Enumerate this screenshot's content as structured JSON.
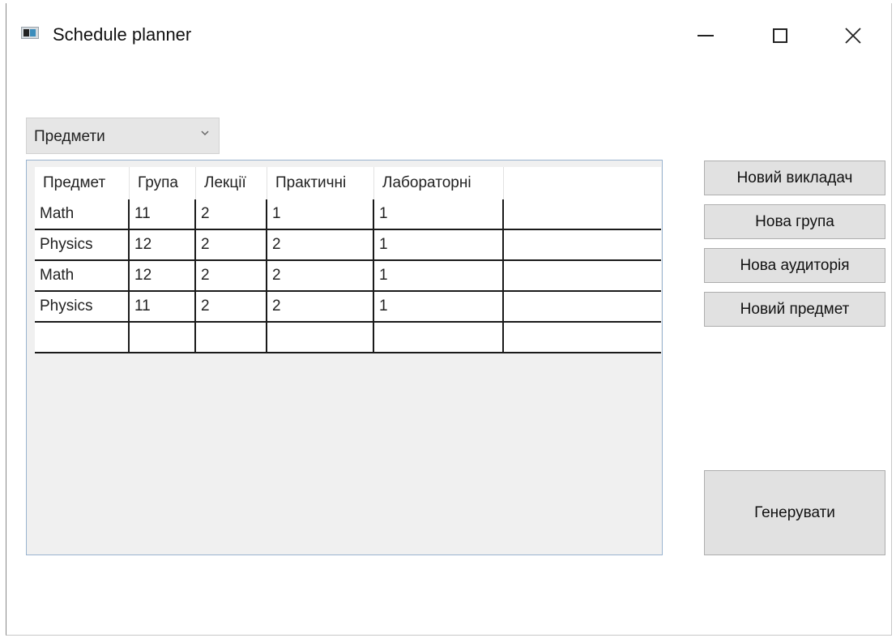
{
  "window": {
    "title": "Schedule planner"
  },
  "controls": {
    "icons": [
      "minimize-icon",
      "maximize-icon",
      "close-icon"
    ]
  },
  "category_select": {
    "selected": "Предмети"
  },
  "table": {
    "columns": [
      "Предмет",
      "Група",
      "Лекції",
      "Практичні",
      "Лабораторні"
    ],
    "rows": [
      [
        "Math",
        "11",
        "2",
        "1",
        "1"
      ],
      [
        "Physics",
        "12",
        "2",
        "2",
        "1"
      ],
      [
        "Math",
        "12",
        "2",
        "2",
        "1"
      ],
      [
        "Physics",
        "11",
        "2",
        "2",
        "1"
      ],
      [
        "",
        "",
        "",
        "",
        ""
      ]
    ]
  },
  "actions": {
    "new_teacher": "Новий викладач",
    "new_group": "Нова група",
    "new_room": "Нова аудиторія",
    "new_subject": "Новий предмет",
    "generate": "Генерувати"
  }
}
